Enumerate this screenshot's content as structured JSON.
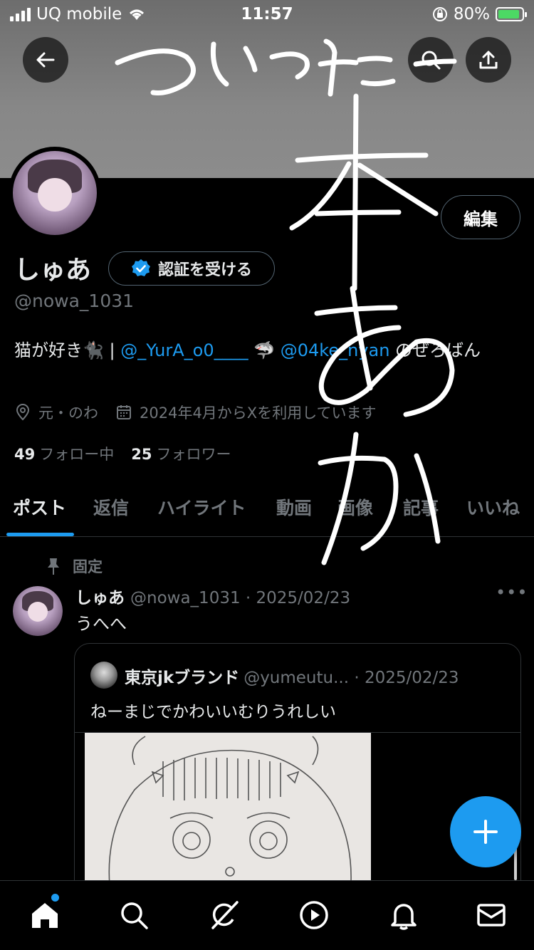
{
  "status_bar": {
    "carrier": "UQ mobile",
    "time": "11:57",
    "battery": "80%"
  },
  "profile": {
    "display_name": "しゅあ",
    "verify_label": "認証を受ける",
    "handle": "@nowa_1031",
    "edit_label": "編集",
    "bio_prefix": "猫が好き🐈‍⬛ | ",
    "bio_link1": "@_YurA_o0____",
    "bio_mid": " 🦈 ",
    "bio_hidden": "@",
    "bio_link2": "04ke_nyan",
    "bio_suffix": " のぜろばん",
    "location": "元・のわ",
    "joined": "2024年4月からXを利用しています",
    "following_count": "49",
    "following_label": "フォロー中",
    "followers_count": "25",
    "followers_label": "フォロワー"
  },
  "tabs": [
    {
      "label": "ポスト"
    },
    {
      "label": "返信"
    },
    {
      "label": "ハイライト"
    },
    {
      "label": "動画"
    },
    {
      "label": "画像"
    },
    {
      "label": "記事"
    },
    {
      "label": "いいね"
    }
  ],
  "pinned_post": {
    "pinned_label": "固定",
    "author": "しゅあ",
    "handle_date": "@nowa_1031 · 2025/02/23",
    "more": "•••",
    "text": "うへへ",
    "quote": {
      "author": "東京jkブランド",
      "handle_date": "@yumeutu... · 2025/02/23",
      "text": "ねーまじでかわいいむりうれしい"
    }
  },
  "overlay_handwriting": "ついった本あか",
  "colors": {
    "accent": "#1d9bf0",
    "background": "#000000",
    "muted_text": "#71767b",
    "banner": "#878787"
  },
  "icons": [
    "back-arrow-icon",
    "search-icon",
    "share-icon",
    "verified-badge-icon",
    "location-icon",
    "calendar-icon",
    "pin-icon",
    "plus-icon",
    "home-icon",
    "explore-icon",
    "grok-icon",
    "play-icon",
    "bell-icon",
    "mail-icon"
  ]
}
